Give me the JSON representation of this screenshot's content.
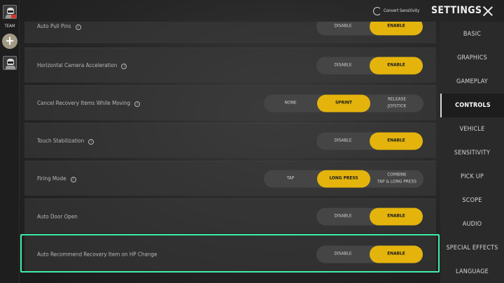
{
  "team": {
    "label": "TEAM"
  },
  "header": {
    "convert_label": "Convert Sensitivity",
    "title": "SETTINGS"
  },
  "sidebar": {
    "items": [
      {
        "label": "BASIC",
        "active": false
      },
      {
        "label": "GRAPHICS",
        "active": false
      },
      {
        "label": "GAMEPLAY",
        "active": false
      },
      {
        "label": "CONTROLS",
        "active": true
      },
      {
        "label": "VEHICLE",
        "active": false
      },
      {
        "label": "SENSITIVITY",
        "active": false
      },
      {
        "label": "PICK UP",
        "active": false
      },
      {
        "label": "SCOPE",
        "active": false
      },
      {
        "label": "AUDIO",
        "active": false
      },
      {
        "label": "SPECIAL EFFECTS",
        "active": false
      },
      {
        "label": "LANGUAGE",
        "active": false
      }
    ]
  },
  "rows": [
    {
      "label": "Auto Pull Pins",
      "info": true,
      "options": [
        "DISABLE",
        "ENABLE"
      ],
      "selected": 1
    },
    {
      "label": "Horizontal Camera Acceleration",
      "info": true,
      "options": [
        "DISABLE",
        "ENABLE"
      ],
      "selected": 1
    },
    {
      "label": "Cancel Recovery Items While Moving",
      "info": true,
      "options": [
        "NONE",
        "SPRINT",
        "RELEASE\nJOYSTICK"
      ],
      "selected": 1
    },
    {
      "label": "Touch Stabilization",
      "info": true,
      "options": [
        "DISABLE",
        "ENABLE"
      ],
      "selected": 1
    },
    {
      "label": "Firing Mode",
      "info": true,
      "options": [
        "TAP",
        "LONG PRESS",
        "COMBINE\nTAP & LONG PRESS"
      ],
      "selected": 1
    },
    {
      "label": "Auto Door Open",
      "info": false,
      "options": [
        "DISABLE",
        "ENABLE"
      ],
      "selected": 1
    },
    {
      "label": "Auto Recommend Recovery Item on HP Change",
      "info": false,
      "options": [
        "DISABLE",
        "ENABLE"
      ],
      "selected": 1
    }
  ],
  "colors": {
    "accent": "#e4b40d",
    "highlight": "#3ff0a8"
  }
}
